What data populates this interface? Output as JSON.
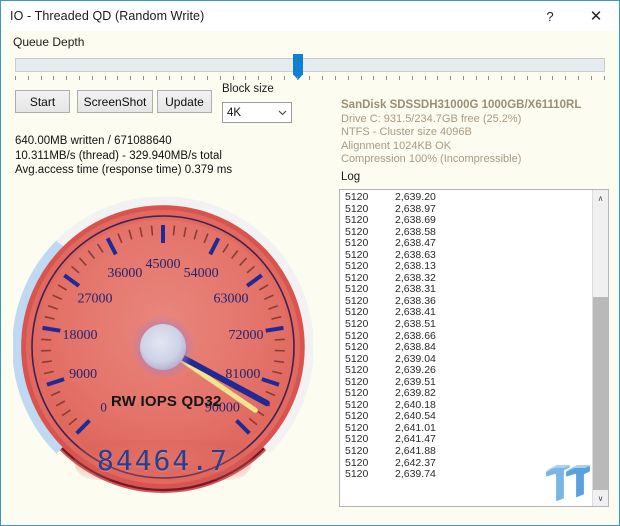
{
  "window": {
    "title": "IO - Threaded QD (Random Write)",
    "help_label": "?",
    "close_label": "✕",
    "border_color": "#3d96c8",
    "background_color": "#fdfcf0"
  },
  "queue_depth": {
    "label": "Queue Depth",
    "thumb_position_percent": 48,
    "tick_count": 47
  },
  "toolbar": {
    "start_label": "Start",
    "screenshot_label": "ScreenShot",
    "update_label": "Update",
    "blocksize_label": "Block size",
    "blocksize_value": "4K",
    "blocksize_options": [
      "4K"
    ],
    "dropdown_arrow": "⌄"
  },
  "stats": {
    "line1": "640.00MB written / 671088640",
    "line2": "10.311MB/s (thread) - 329.940MB/s total",
    "line3": "Avg.access time (response time) 0.379 ms"
  },
  "drive": {
    "model": "SanDisk SDSSDH31000G 1000GB/X61110RL",
    "capacity": "Drive C: 931.5/234.7GB free (25.2%)",
    "filesystem": "NTFS - Cluster size 4096B",
    "alignment": "Alignment 1024KB OK",
    "compression": "Compression 100% (Incompressible)",
    "title_color": "#9a8e76",
    "line_color": "#a79b84"
  },
  "log": {
    "label": "Log",
    "scroll_up_arrow": "∧",
    "scroll_down_arrow": "∨",
    "rows": [
      {
        "size": "5120",
        "value": "2,639.20"
      },
      {
        "size": "5120",
        "value": "2,638.97"
      },
      {
        "size": "5120",
        "value": "2,638.69"
      },
      {
        "size": "5120",
        "value": "2,638.58"
      },
      {
        "size": "5120",
        "value": "2,638.47"
      },
      {
        "size": "5120",
        "value": "2,638.63"
      },
      {
        "size": "5120",
        "value": "2,638.13"
      },
      {
        "size": "5120",
        "value": "2,638.32"
      },
      {
        "size": "5120",
        "value": "2,638.31"
      },
      {
        "size": "5120",
        "value": "2,638.36"
      },
      {
        "size": "5120",
        "value": "2,638.41"
      },
      {
        "size": "5120",
        "value": "2,638.51"
      },
      {
        "size": "5120",
        "value": "2,638.66"
      },
      {
        "size": "5120",
        "value": "2,638.84"
      },
      {
        "size": "5120",
        "value": "2,639.04"
      },
      {
        "size": "5120",
        "value": "2,639.26"
      },
      {
        "size": "5120",
        "value": "2,639.51"
      },
      {
        "size": "5120",
        "value": "2,639.82"
      },
      {
        "size": "5120",
        "value": "2,640.18"
      },
      {
        "size": "5120",
        "value": "2,640.54"
      },
      {
        "size": "5120",
        "value": "2,641.01"
      },
      {
        "size": "5120",
        "value": "2,641.47"
      },
      {
        "size": "5120",
        "value": "2,641.88"
      },
      {
        "size": "5120",
        "value": "2,642.37"
      },
      {
        "size": "5120",
        "value": "2,639.74"
      }
    ]
  },
  "gauge": {
    "caption": "RW IOPS QD32",
    "readout": "84464.7",
    "value": 84464.7,
    "min": 0,
    "max": 90000,
    "major_ticks": [
      "0",
      "9000",
      "18000",
      "27000",
      "36000",
      "45000",
      "54000",
      "63000",
      "72000",
      "81000",
      "90000"
    ],
    "face_color": "#e36b63",
    "rim_color": "#c0392b",
    "needle_color": "#1f2a96",
    "secondary_needle_color": "#f2e58c",
    "progress_arc_color": "#bfd9f2",
    "remaining_arc_color": "#efefef",
    "digit_color": "#2b3e8c"
  },
  "watermark": {
    "name": "tweaktown-logo",
    "text": "TT",
    "color": "#6ab0e8"
  }
}
